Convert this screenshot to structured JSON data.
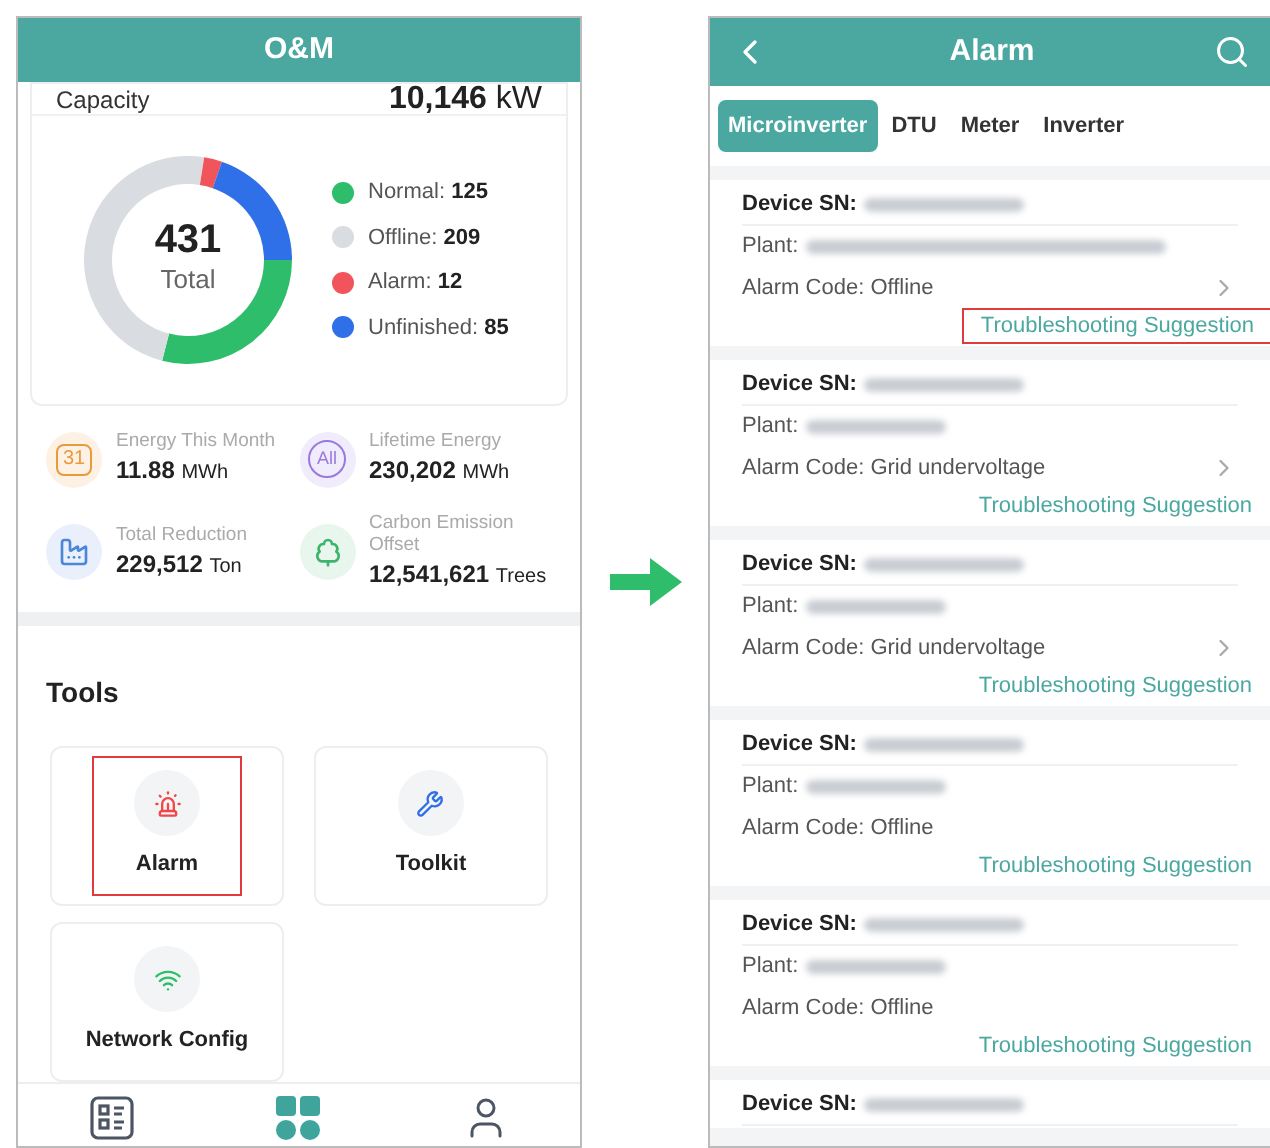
{
  "left_screen": {
    "header": {
      "title": "O&M"
    },
    "capacity": {
      "label": "Capacity",
      "value": "10,146",
      "unit": "kW"
    },
    "status_chart": {
      "center_value": "431",
      "center_label": "Total",
      "legend": [
        {
          "label": "Normal:",
          "value": "125",
          "color": "#2ebd6b"
        },
        {
          "label": "Offline:",
          "value": "209",
          "color": "#d9dce1"
        },
        {
          "label": "Alarm:",
          "value": "12",
          "color": "#f2545b"
        },
        {
          "label": "Unfinished:",
          "value": "85",
          "color": "#2f6fe8"
        }
      ]
    },
    "stats": [
      {
        "icon_text": "31",
        "kind": "calendar",
        "label": "Energy This Month",
        "value": "11.88",
        "unit": "MWh"
      },
      {
        "icon_text": "All",
        "kind": "all",
        "label": "Lifetime Energy",
        "value": "230,202",
        "unit": "MWh"
      },
      {
        "kind": "factory",
        "label": "Total Reduction",
        "value": "229,512",
        "unit": "Ton"
      },
      {
        "kind": "tree",
        "label": "Carbon Emission Offset",
        "value": "12,541,621",
        "unit": "Trees"
      }
    ],
    "tools": {
      "title": "Tools",
      "items": [
        {
          "kind": "alarm",
          "label": "Alarm",
          "highlighted": true
        },
        {
          "kind": "toolkit",
          "label": "Toolkit",
          "highlighted": false
        },
        {
          "kind": "network",
          "label": "Network Config",
          "highlighted": false
        }
      ]
    },
    "bottom_nav": [
      {
        "kind": "list",
        "selected": false
      },
      {
        "kind": "grid",
        "selected": true
      },
      {
        "kind": "user",
        "selected": false
      }
    ]
  },
  "right_screen": {
    "header": {
      "title": "Alarm"
    },
    "tabs": [
      {
        "label": "Microinverter",
        "selected": true
      },
      {
        "label": "DTU",
        "selected": false
      },
      {
        "label": "Meter",
        "selected": false
      },
      {
        "label": "Inverter",
        "selected": false
      }
    ],
    "alarms": [
      {
        "sn_label": "Device SN:",
        "plant_label": "Plant:",
        "code": "Alarm Code: Offline",
        "has_arrow": true,
        "link": "Troubleshooting Suggestion",
        "highlighted": true
      },
      {
        "sn_label": "Device SN:",
        "plant_label": "Plant:",
        "code": "Alarm Code: Grid undervoltage",
        "has_arrow": true,
        "link": "Troubleshooting Suggestion",
        "highlighted": false
      },
      {
        "sn_label": "Device SN:",
        "plant_label": "Plant:",
        "code": "Alarm Code: Grid undervoltage",
        "has_arrow": true,
        "link": "Troubleshooting Suggestion",
        "highlighted": false
      },
      {
        "sn_label": "Device SN:",
        "plant_label": "Plant:",
        "code": "Alarm Code: Offline",
        "has_arrow": false,
        "link": "Troubleshooting Suggestion",
        "highlighted": false
      },
      {
        "sn_label": "Device SN:",
        "plant_label": "Plant:",
        "code": "Alarm Code: Offline",
        "has_arrow": false,
        "link": "Troubleshooting Suggestion",
        "highlighted": false
      },
      {
        "sn_label": "Device SN:"
      }
    ]
  }
}
